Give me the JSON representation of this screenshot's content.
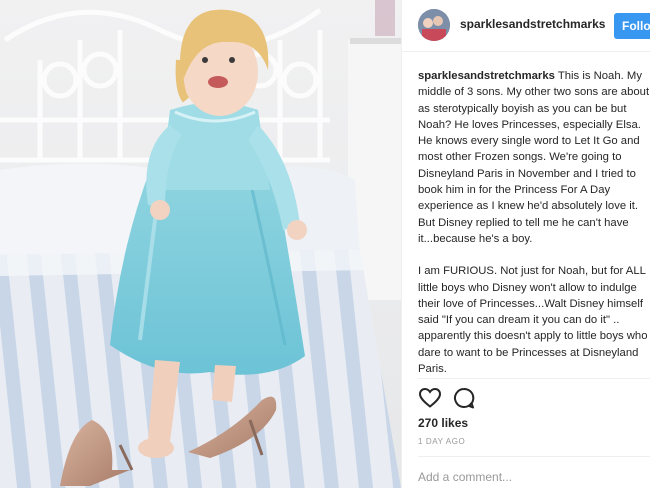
{
  "post": {
    "username": "sparklesandstretchmarks",
    "follow_label": "Follow",
    "caption_paragraphs": [
      "This is Noah. My middle of 3 sons. My other two sons are about as sterotypically boyish as you can be but Noah? He loves Princesses, especially Elsa. He knows every single word to Let It Go and most other Frozen songs. We're going to Disneyland Paris in November and I tried to book him in for the Princess For A Day experience as I knew he'd absolutely love it. But Disney replied to tell me he can't have it...because he's a boy.",
      "I am FURIOUS. Not just for Noah, but for ALL little boys who Disney won't allow to indulge their love of Princesses...Walt Disney himself said \"If you can dream it you can do it\" .. apparently this doesn't apply to little boys who dare to want to be Princesses at Disneyland Paris."
    ],
    "likes": "270 likes",
    "timestamp": "1 DAY AGO",
    "comment_placeholder": "Add a comment..."
  },
  "icons": {
    "like": "heart-icon",
    "comment": "comment-bubble-icon"
  },
  "colors": {
    "follow_button": "#3897f0",
    "text": "#262626",
    "muted": "#999999",
    "divider": "#efefef"
  }
}
